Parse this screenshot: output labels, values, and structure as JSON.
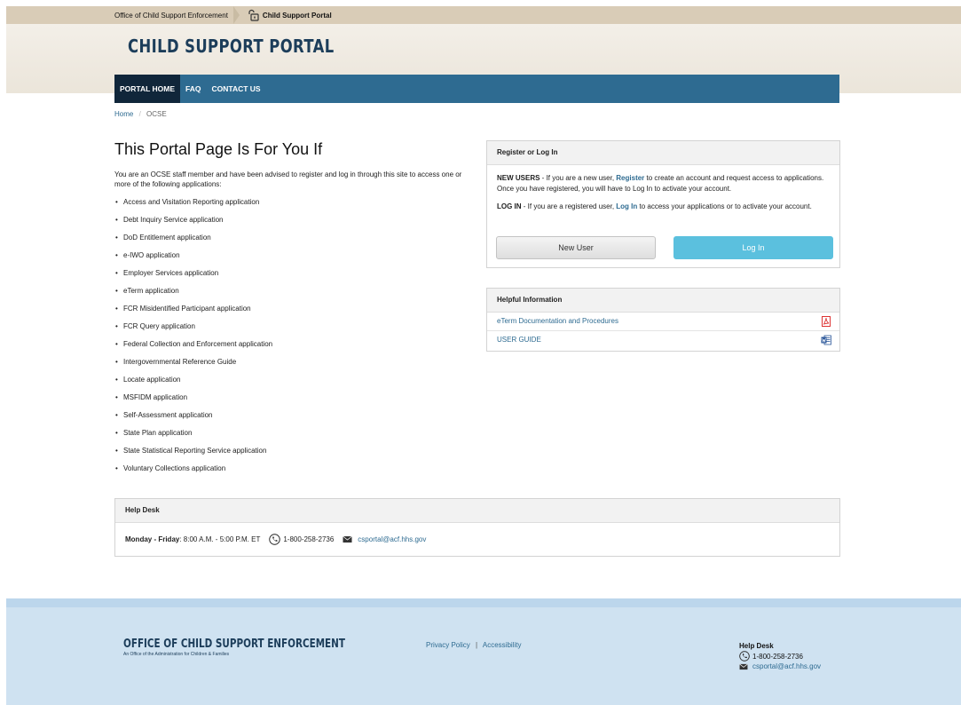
{
  "topbar": {
    "agency": "Office of Child Support Enforcement",
    "portal": "Child Support Portal"
  },
  "header": {
    "title": "CHILD SUPPORT PORTAL"
  },
  "nav": {
    "items": [
      "PORTAL HOME",
      "FAQ",
      "CONTACT US"
    ]
  },
  "breadcrumb": {
    "home": "Home",
    "sep": "/",
    "current": "OCSE"
  },
  "main": {
    "title": "This Portal Page Is For You If",
    "intro": "You are an OCSE staff member and have been advised to register and log in through this site to access one or more of the following applications:",
    "apps": [
      "Access and Visitation Reporting application",
      "Debt Inquiry Service application",
      "DoD Entitlement application",
      "e-IWO application",
      "Employer Services application",
      "eTerm application",
      "FCR Misidentified Participant application",
      "FCR Query application",
      "Federal Collection and Enforcement application",
      "Intergovernmental Reference Guide",
      "Locate application",
      "MSFIDM application",
      "Self-Assessment application",
      "State Plan application",
      "State Statistical Reporting Service application",
      "Voluntary Collections application"
    ]
  },
  "register": {
    "heading": "Register or Log In",
    "new_users_label": "NEW USERS",
    "new_users_pre": " - If you are a new user, ",
    "register_link": "Register",
    "new_users_post": " to create an account and request access to applications. Once you have registered, you will have to Log In to activate your account.",
    "login_label": "LOG IN",
    "login_pre": " - If you are a registered user, ",
    "login_link": "Log In",
    "login_post": " to access your applications or to activate your account.",
    "new_user_button": "New User",
    "login_button": "Log In"
  },
  "helpful": {
    "heading": "Helpful Information",
    "items": [
      {
        "label": "eTerm Documentation and Procedures",
        "icon": "pdf-icon"
      },
      {
        "label": "USER GUIDE",
        "icon": "word-doc-icon"
      }
    ]
  },
  "helpdesk": {
    "heading": "Help Desk",
    "days": "Monday - Friday",
    "hours": ": 8:00 A.M. - 5:00 P.M. ET",
    "phone": "1-800-258-2736",
    "email": "csportal@acf.hhs.gov"
  },
  "footer": {
    "org": "OFFICE OF CHILD SUPPORT ENFORCEMENT",
    "sub": "An Office of the Administration for Children & Families",
    "privacy": "Privacy Policy",
    "sep": "|",
    "accessibility": "Accessibility",
    "help_title": "Help Desk",
    "phone": "1-800-258-2736",
    "email": "csportal@acf.hhs.gov"
  },
  "colors": {
    "nav": "#2e6b91",
    "nav_active": "#10263a",
    "link": "#2e6b91",
    "login_button": "#5bc0de",
    "footer": "#cfe2f1"
  }
}
